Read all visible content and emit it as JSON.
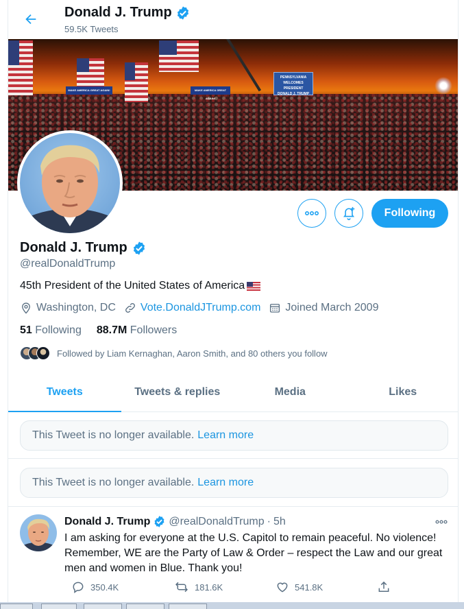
{
  "header": {
    "name": "Donald J. Trump",
    "tweet_count": "59.5K Tweets"
  },
  "banner": {
    "stage_sign_lines": [
      "PENNSYLVANIA",
      "WELCOMES",
      "PRESIDENT",
      "DONALD J. TRUMP"
    ],
    "side_sign": "MAKE AMERICA GREAT AGAIN!"
  },
  "profile": {
    "name": "Donald J. Trump",
    "handle": "@realDonaldTrump",
    "bio": "45th President of the United States of America",
    "location": "Washington, DC",
    "website": "Vote.DonaldJTrump.com",
    "joined": "Joined March 2009",
    "following_count": "51",
    "following_label": "Following",
    "followers_count": "88.7M",
    "followers_label": "Followers",
    "followed_by": "Followed by Liam Kernaghan, Aaron Smith, and 80 others you follow",
    "follow_button": "Following"
  },
  "tabs": [
    {
      "label": "Tweets",
      "active": true
    },
    {
      "label": "Tweets & replies",
      "active": false
    },
    {
      "label": "Media",
      "active": false
    },
    {
      "label": "Likes",
      "active": false
    }
  ],
  "unavailable_tweets": [
    {
      "text": "This Tweet is no longer available.",
      "link": "Learn more"
    },
    {
      "text": "This Tweet is no longer available.",
      "link": "Learn more"
    }
  ],
  "tweet": {
    "name": "Donald J. Trump",
    "handle": "@realDonaldTrump",
    "separator": "·",
    "time": "5h",
    "text_lines": [
      "I am asking for everyone at the U.S. Capitol to remain peaceful. No violence!",
      "Remember, WE are the Party of Law & Order – respect the Law and our great",
      "men and women in Blue. Thank you!"
    ],
    "replies": "350.4K",
    "retweets": "181.6K",
    "likes": "541.8K"
  },
  "icons": {
    "back": "arrow-left-icon",
    "verified": "verified-badge-icon",
    "more": "more-dots-icon",
    "notify": "bell-plus-icon",
    "location": "location-pin-icon",
    "link": "link-icon",
    "calendar": "calendar-icon",
    "reply": "reply-icon",
    "retweet": "retweet-icon",
    "like": "heart-icon",
    "share": "share-icon"
  },
  "colors": {
    "accent": "#1da1f2",
    "link": "#1b95e0",
    "secondary_text": "#5b7083",
    "border": "#e6ecf0"
  }
}
